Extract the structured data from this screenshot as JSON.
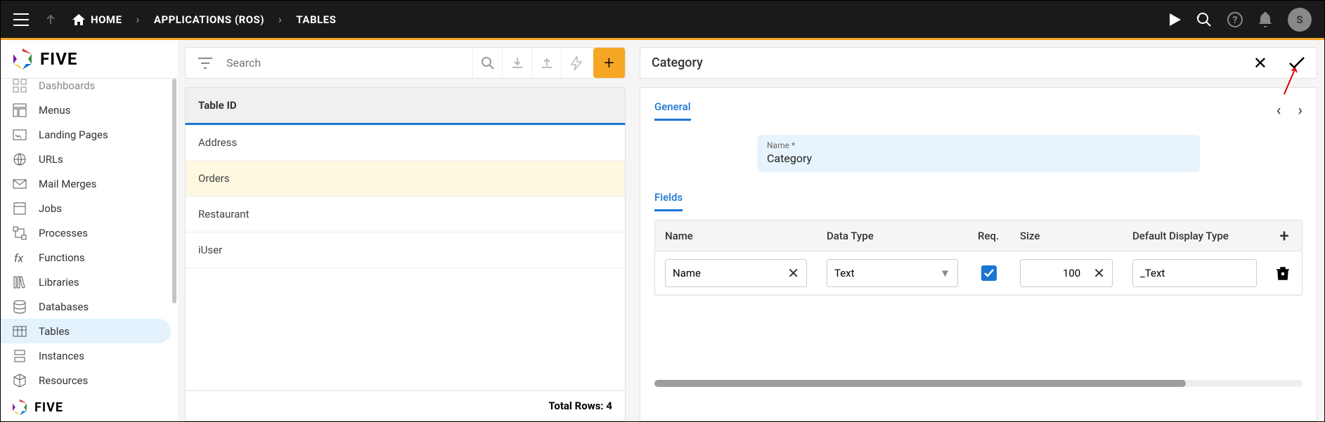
{
  "topbar": {
    "breadcrumb": [
      "HOME",
      "APPLICATIONS (ROS)",
      "TABLES"
    ],
    "avatar_initial": "S"
  },
  "sidebar": {
    "items": [
      {
        "label": "Dashboards"
      },
      {
        "label": "Menus"
      },
      {
        "label": "Landing Pages"
      },
      {
        "label": "URLs"
      },
      {
        "label": "Mail Merges"
      },
      {
        "label": "Jobs"
      },
      {
        "label": "Processes"
      },
      {
        "label": "Functions"
      },
      {
        "label": "Libraries"
      },
      {
        "label": "Databases"
      },
      {
        "label": "Tables"
      },
      {
        "label": "Instances"
      },
      {
        "label": "Resources"
      }
    ]
  },
  "search": {
    "placeholder": "Search"
  },
  "list": {
    "header": "Table ID",
    "rows": [
      "Address",
      "Orders",
      "Restaurant",
      "iUser"
    ],
    "footer_label": "Total Rows:",
    "footer_count": "4"
  },
  "detail": {
    "title": "Category",
    "general_tab": "General",
    "name_label": "Name *",
    "name_value": "Category",
    "fields_tab": "Fields",
    "columns": {
      "name": "Name",
      "type": "Data Type",
      "req": "Req.",
      "size": "Size",
      "disp": "Default Display Type"
    },
    "row": {
      "name": "Name",
      "type": "Text",
      "req": true,
      "size": "100",
      "disp": "_Text"
    }
  }
}
